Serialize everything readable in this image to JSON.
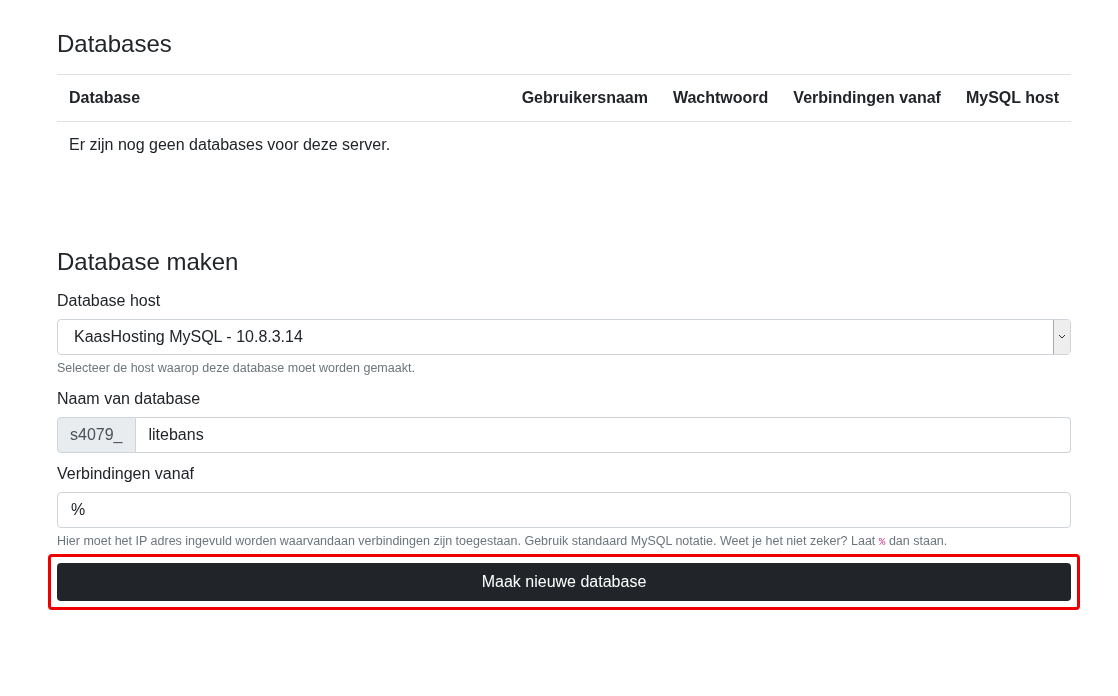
{
  "databases": {
    "title": "Databases",
    "columns": [
      "Database",
      "Gebruikersnaam",
      "Wachtwoord",
      "Verbindingen vanaf",
      "MySQL host"
    ],
    "empty_message": "Er zijn nog geen databases voor deze server."
  },
  "create": {
    "title": "Database maken",
    "fields": [
      {
        "kind": "select",
        "label": "Database host",
        "value": "KaasHosting MySQL - 10.8.3.14",
        "help": [
          "Selecteer de host waarop deze database moet worden gemaakt."
        ]
      },
      {
        "kind": "prefixed",
        "label": "Naam van database",
        "prefix": "s4079_",
        "value": "litebans"
      },
      {
        "kind": "text",
        "label": "Verbindingen vanaf",
        "value": "%",
        "help": [
          "Hier moet het IP adres ingevuld worden waarvandaan verbindingen zijn toegestaan. Gebruik standaard MySQL notatie. Weet je het niet zeker? Laat ",
          "%",
          " dan staan."
        ]
      }
    ],
    "submit": {
      "label": "Maak nieuwe database",
      "highlighted": true
    }
  }
}
